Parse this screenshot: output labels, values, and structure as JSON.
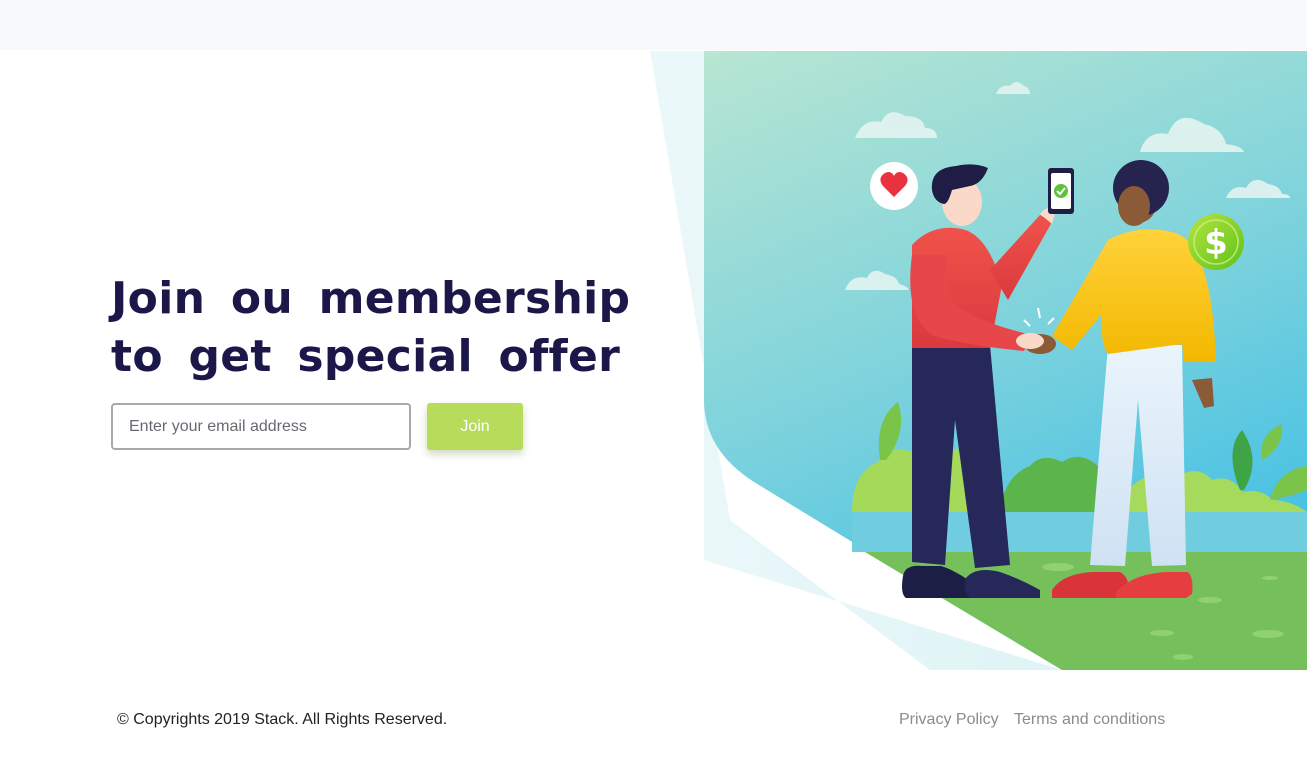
{
  "hero": {
    "title_line1": "Join ou membership",
    "title_line2": "to get special offer"
  },
  "signup": {
    "email_placeholder": "Enter your email address",
    "join_label": "Join",
    "join_color": "#b7db5b"
  },
  "illustration": {
    "icons": [
      "heart-icon",
      "phone-check-icon",
      "dollar-coin-icon",
      "cloud-icon",
      "bush-icon",
      "leaf-icon"
    ]
  },
  "footer": {
    "copyright": "© Copyrights 2019 Stack. All Rights Reserved.",
    "links": [
      "Privacy Policy",
      "Terms and conditions"
    ]
  },
  "colors": {
    "title": "#1b1849",
    "accent_green": "#b7db5b",
    "sky_top": "#b8e6d2",
    "sky_bottom": "#46c1e4",
    "grass": "#76c05c"
  }
}
